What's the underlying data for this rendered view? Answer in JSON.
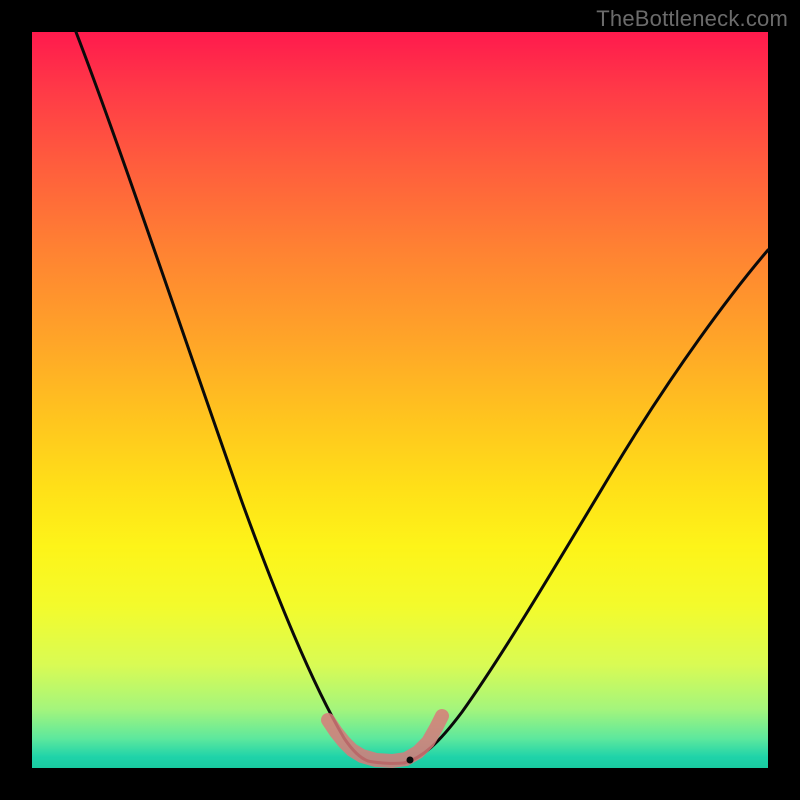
{
  "watermark": "TheBottleneck.com",
  "colors": {
    "background": "#000000",
    "curve": "#0a0a0a",
    "marker": "#d87a7a",
    "gradient_stops": [
      "#ff1a4d",
      "#ff3a47",
      "#ff5d3d",
      "#ff8332",
      "#ffa528",
      "#ffc31f",
      "#ffe018",
      "#fdf419",
      "#f3fb2c",
      "#d9fb54",
      "#a4f57c",
      "#5de89d",
      "#1fd3a9",
      "#19caa0"
    ]
  },
  "chart_data": {
    "type": "line",
    "title": "",
    "xlabel": "",
    "ylabel": "",
    "xlim": [
      0,
      100
    ],
    "ylim": [
      0,
      100
    ],
    "series": [
      {
        "name": "left-branch",
        "x": [
          6,
          10,
          15,
          20,
          25,
          30,
          33,
          36,
          38,
          40,
          42,
          44
        ],
        "y": [
          100,
          88,
          72,
          55,
          40,
          26,
          18,
          11,
          7,
          4,
          2,
          1
        ]
      },
      {
        "name": "right-branch",
        "x": [
          50,
          53,
          56,
          60,
          65,
          70,
          76,
          82,
          88,
          94,
          100
        ],
        "y": [
          1,
          2,
          4,
          8,
          14,
          22,
          32,
          43,
          53,
          62,
          70
        ]
      },
      {
        "name": "flat-bottom",
        "x": [
          44,
          46,
          48,
          50
        ],
        "y": [
          1,
          0.5,
          0.5,
          1
        ]
      }
    ],
    "highlight": {
      "name": "marker-L-shape",
      "x": [
        40,
        41.5,
        43,
        44.5,
        46.5,
        49,
        51,
        52.5,
        54,
        55
      ],
      "y": [
        6,
        4,
        2.5,
        1.5,
        1,
        1,
        1.5,
        3,
        5,
        7
      ]
    }
  }
}
